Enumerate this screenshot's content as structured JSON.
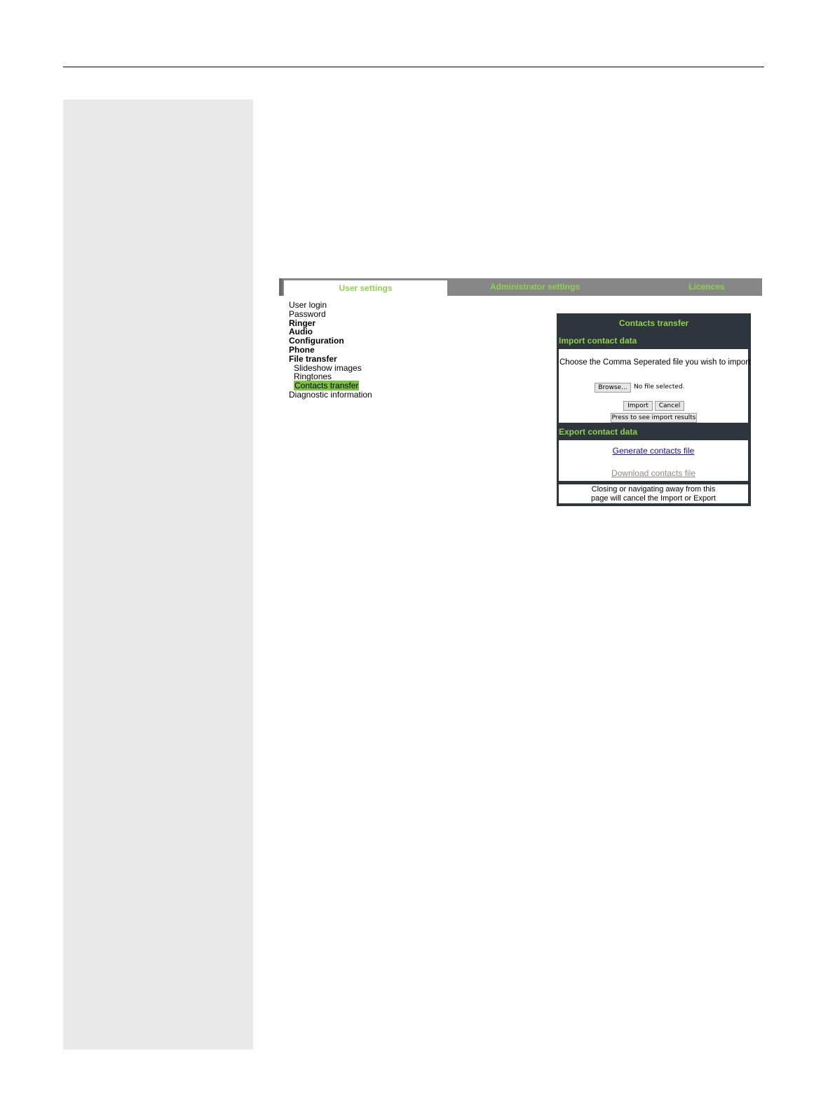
{
  "tabs": {
    "user_settings": "User settings",
    "administrator_settings": "Administrator settings",
    "licences": "Licences"
  },
  "nav": {
    "user_login": "User login",
    "password": "Password",
    "ringer": "Ringer",
    "audio": "Audio",
    "configuration": "Configuration",
    "phone": "Phone",
    "file_transfer": "File transfer",
    "slideshow_images": "Slideshow images",
    "ringtones": "Ringtones",
    "contacts_transfer": "Contacts transfer",
    "diagnostic_information": "Diagnostic information",
    "selected": "Contacts transfer"
  },
  "panel": {
    "title": "Contacts transfer",
    "import_title": "Import contact data",
    "import_prompt": "Choose the Comma Seperated file you wish to import",
    "browse_label": "Browse...",
    "file_status": "No file selected.",
    "import_label": "Import",
    "cancel_label": "Cancel",
    "results_label": "Press to see import results",
    "export_title": "Export contact data",
    "generate_link": "Generate contacts file",
    "download_link": "Download contacts file",
    "note_line1": "Closing or navigating away from this",
    "note_line2": "page will cancel the Import or Export"
  },
  "colors": {
    "accent_green": "#8bd34a",
    "selection_green": "#7cc242",
    "panel_bg": "#2e353d",
    "tabbar_bg": "#878787",
    "margin_bg": "#e8e8e8"
  }
}
